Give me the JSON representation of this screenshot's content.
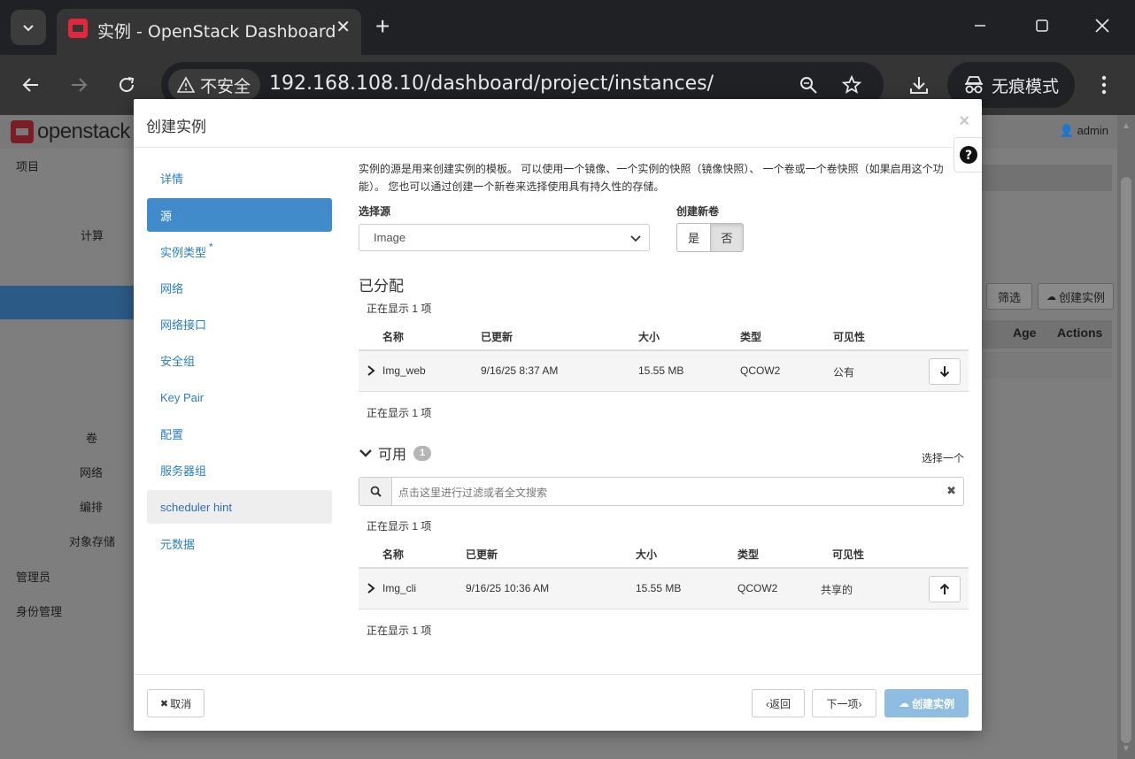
{
  "browser": {
    "tab_title": "实例 - OpenStack Dashboard",
    "security_label": "不安全",
    "url": "192.168.108.10/dashboard/project/instances/",
    "incognito_label": "无痕模式"
  },
  "background": {
    "logo_text": "openstack",
    "user": "admin",
    "nav": {
      "project": "项目",
      "compute": "计算",
      "volumes": "卷",
      "network": "网络",
      "orchestration": "编排",
      "object_store": "对象存储",
      "admin": "管理员",
      "identity": "身份管理"
    },
    "filter_button": "筛选",
    "create_instance_button": "创建实例",
    "columns": {
      "age": "Age",
      "actions": "Actions"
    }
  },
  "modal": {
    "title": "创建实例",
    "close_glyph": "×",
    "help_glyph": "?",
    "nav": [
      {
        "label": "详情"
      },
      {
        "label": "源"
      },
      {
        "label": "实例类型",
        "required": "*"
      },
      {
        "label": "网络"
      },
      {
        "label": "网络接口"
      },
      {
        "label": "安全组"
      },
      {
        "label": "Key Pair"
      },
      {
        "label": "配置"
      },
      {
        "label": "服务器组"
      },
      {
        "label": "scheduler hint"
      },
      {
        "label": "元数据"
      }
    ],
    "description": "实例的源是用来创建实例的模板。 可以使用一个镜像、一个实例的快照（镜像快照）、 一个卷或一个卷快照（如果启用这个功能）。 您也可以通过创建一个新卷来选择使用具有持久性的存储。",
    "select_source_label": "选择源",
    "select_source_value": "Image",
    "create_volume_label": "创建新卷",
    "create_volume_yes": "是",
    "create_volume_no": "否",
    "allocated": {
      "title": "已分配",
      "showing_top": "正在显示 1 项",
      "showing_bottom": "正在显示 1 项",
      "headers": {
        "name": "名称",
        "updated": "已更新",
        "size": "大小",
        "type": "类型",
        "visibility": "可见性"
      },
      "rows": [
        {
          "name": "Img_web",
          "updated": "9/16/25 8:37 AM",
          "size": "15.55 MB",
          "type": "QCOW2",
          "visibility": "公有"
        }
      ]
    },
    "available": {
      "title": "可用",
      "count": "1",
      "select_one": "选择一个",
      "search_placeholder": "点击这里进行过滤或者全文搜索",
      "showing_top": "正在显示 1 项",
      "showing_bottom": "正在显示 1 项",
      "headers": {
        "name": "名称",
        "updated": "已更新",
        "size": "大小",
        "type": "类型",
        "visibility": "可见性"
      },
      "rows": [
        {
          "name": "Img_cli",
          "updated": "9/16/25 10:36 AM",
          "size": "15.55 MB",
          "type": "QCOW2",
          "visibility": "共享的"
        }
      ]
    },
    "footer": {
      "cancel": "取消",
      "back": "‹返回",
      "next": "下一项›",
      "create": "创建实例"
    }
  }
}
